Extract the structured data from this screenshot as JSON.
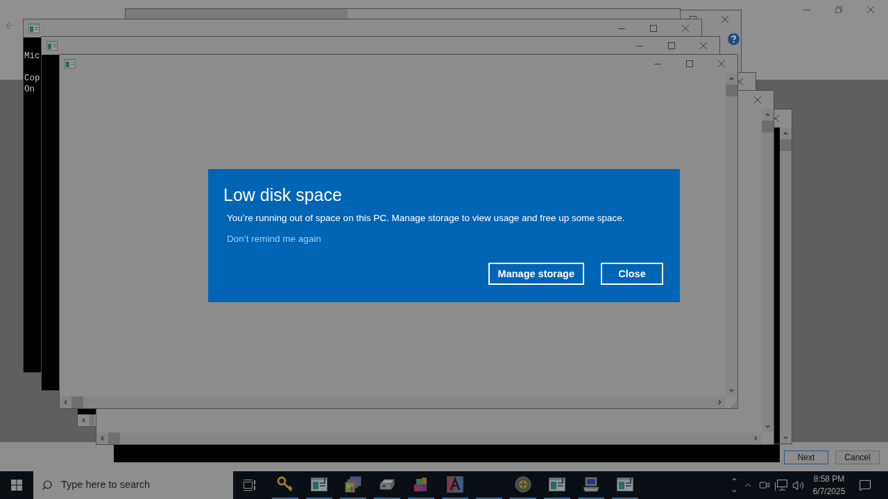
{
  "console_windows": [
    {
      "paragraphs": [
        [
          "Mic"
        ],
        [
          "Cop",
          "On"
        ]
      ]
    }
  ],
  "setup_wizard": {
    "buttons": [
      {
        "label": "Next",
        "focused": true
      },
      {
        "label": "Cancel",
        "focused": false
      }
    ]
  },
  "dialog": {
    "title": "Low disk space",
    "message": "You’re running out of space on this PC. Manage storage to view usage and free up some space.",
    "link": "Don’t remind me again",
    "buttons": [
      "Manage storage",
      "Close"
    ]
  },
  "taskbar": {
    "search": {
      "placeholder": "Type here to search"
    },
    "apps": [
      {
        "kind": "key",
        "running": true
      },
      {
        "kind": "window",
        "running": true
      },
      {
        "kind": "pictures",
        "running": true
      },
      {
        "kind": "drive",
        "running": true
      },
      {
        "kind": "package",
        "running": true
      },
      {
        "kind": "font",
        "running": true
      },
      {
        "kind": "blank",
        "running": true
      },
      {
        "kind": "globe",
        "running": true
      },
      {
        "kind": "window",
        "running": true
      },
      {
        "kind": "computer",
        "running": true
      },
      {
        "kind": "window",
        "running": true
      }
    ],
    "clock": {
      "time": "8:58 PM",
      "date": "6/7/2025"
    }
  }
}
